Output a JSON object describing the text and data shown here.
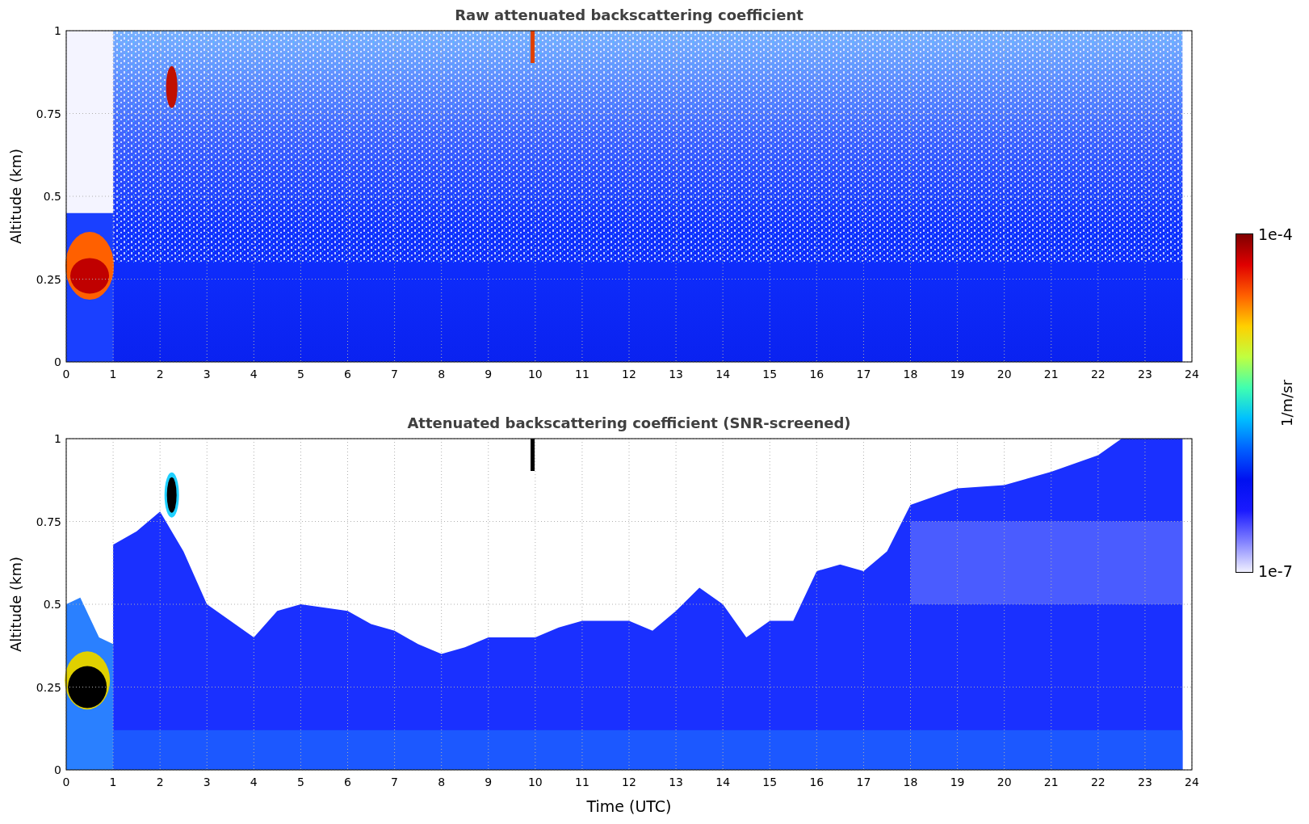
{
  "panels": [
    {
      "kind": "raw",
      "title": "Raw attenuated backscattering coefficient",
      "ylabel": "Altitude (km)",
      "yticks": [
        "1",
        "0.75",
        "0.5",
        "0.25",
        "0"
      ],
      "xticks": [
        "0",
        "1",
        "2",
        "3",
        "4",
        "5",
        "6",
        "7",
        "8",
        "9",
        "10",
        "11",
        "12",
        "13",
        "14",
        "15",
        "16",
        "17",
        "18",
        "19",
        "20",
        "21",
        "22",
        "23",
        "24"
      ]
    },
    {
      "kind": "screened",
      "title": "Attenuated backscattering coefficient (SNR-screened)",
      "ylabel": "Altitude (km)",
      "yticks": [
        "1",
        "0.75",
        "0.5",
        "0.25",
        "0"
      ],
      "xticks": [
        "0",
        "1",
        "2",
        "3",
        "4",
        "5",
        "6",
        "7",
        "8",
        "9",
        "10",
        "11",
        "12",
        "13",
        "14",
        "15",
        "16",
        "17",
        "18",
        "19",
        "20",
        "21",
        "22",
        "23",
        "24"
      ],
      "xlabel": "Time (UTC)"
    }
  ],
  "colorbar": {
    "label": "1/m/sr",
    "max_label": "1e-4",
    "min_label": "1e-7"
  }
}
